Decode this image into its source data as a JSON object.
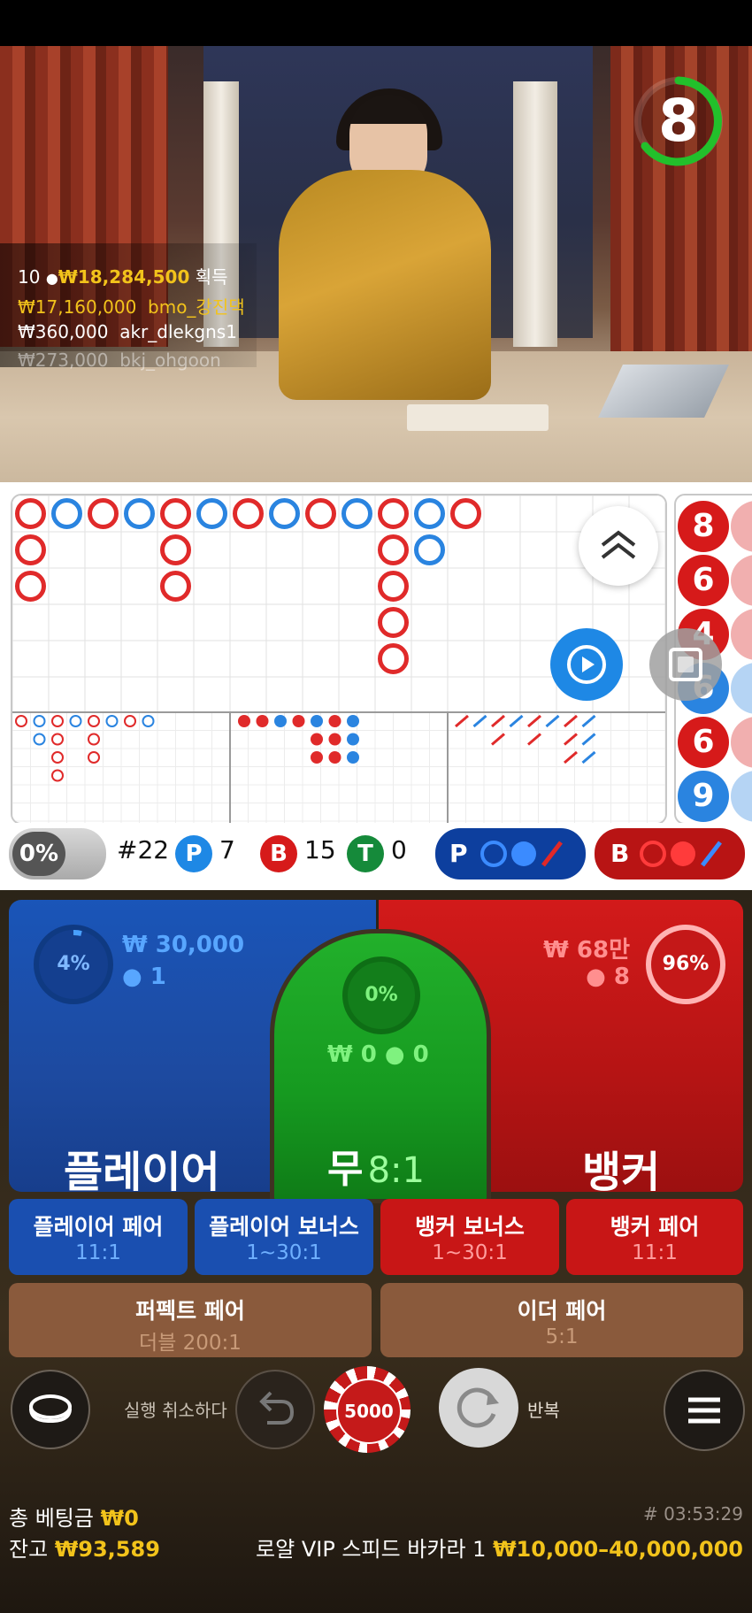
{
  "timer": {
    "value": "8"
  },
  "winners": {
    "summary_count": "10",
    "summary_amount": "₩18,284,500",
    "summary_suffix": "획득",
    "rows": [
      {
        "amount": "₩17,160,000",
        "name": "bmo_강진댁"
      },
      {
        "amount": "₩360,000",
        "name": "akr_dlekgns1"
      },
      {
        "amount": "₩273,000",
        "name": "bkj_ohgoon"
      }
    ]
  },
  "stats": {
    "percent": "0%",
    "round": "#22",
    "p_label": "P",
    "p_count": "7",
    "b_label": "B",
    "b_count": "15",
    "t_label": "T",
    "t_count": "0",
    "player_predict": "P",
    "banker_predict": "B"
  },
  "right_road": [
    "8",
    "6",
    "4",
    "6",
    "6",
    "9"
  ],
  "player_zone": {
    "percent": "4%",
    "amount": "₩ 30,000",
    "players": "1",
    "label": "플레이어"
  },
  "tie_zone": {
    "percent": "0%",
    "amount": "₩ 0",
    "players": "0",
    "label": "무",
    "odds": "8:1"
  },
  "banker_zone": {
    "percent": "96%",
    "amount": "₩ 68만",
    "players": "8",
    "label": "뱅커"
  },
  "side_bets": [
    {
      "title": "플레이어 페어",
      "odds": "11:1"
    },
    {
      "title": "플레이어 보너스",
      "odds": "1~30:1"
    },
    {
      "title": "뱅커 보너스",
      "odds": "1~30:1"
    },
    {
      "title": "뱅커 페어",
      "odds": "11:1"
    }
  ],
  "extra_bets": [
    {
      "title": "퍼펙트 페어",
      "odds": "더블 200:1"
    },
    {
      "title": "이더 페어",
      "odds": "5:1"
    }
  ],
  "controls": {
    "undo_label": "실행 취소하다",
    "chip_value": "5000",
    "repeat_label": "반복"
  },
  "footer": {
    "total_bet_label": "총 베팅금",
    "total_bet_value": "₩0",
    "balance_label": "잔고",
    "balance_value": "₩93,589",
    "game_id": "# 03:53:29",
    "table_name": "로얄 VIP 스피드 바카라 1",
    "limits": "₩10,000–40,000,000"
  },
  "colors": {
    "player": "#1a55b8",
    "banker": "#d21a1a",
    "tie": "#22b02b",
    "gold": "#f2c31b"
  }
}
